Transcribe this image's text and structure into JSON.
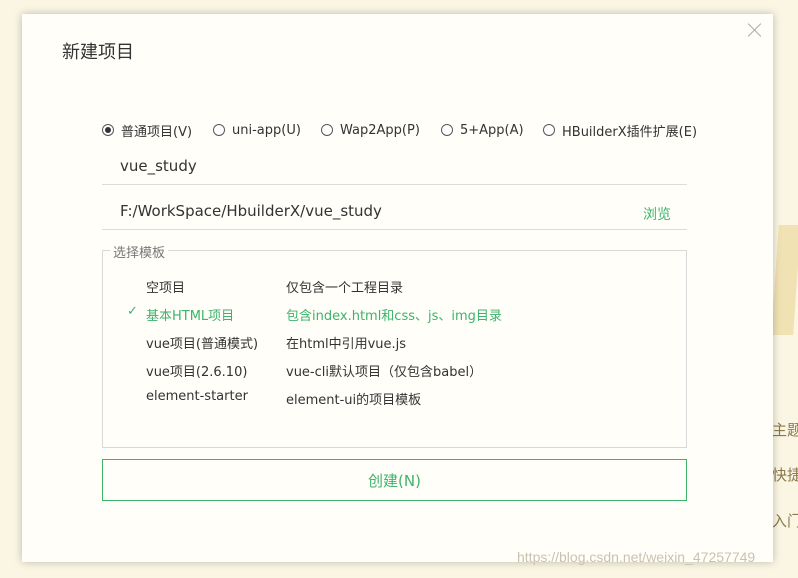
{
  "dialog": {
    "title": "新建项目",
    "close": "×"
  },
  "project_types": [
    {
      "label": "普通项目(V)",
      "selected": true
    },
    {
      "label": "uni-app(U)",
      "selected": false
    },
    {
      "label": "Wap2App(P)",
      "selected": false
    },
    {
      "label": "5+App(A)",
      "selected": false
    },
    {
      "label": "HBuilderX插件扩展(E)",
      "selected": false
    }
  ],
  "project_name": {
    "value": "vue_study"
  },
  "project_path": {
    "value": "F:/WorkSpace/HbuilderX/vue_study",
    "browse_label": "浏览"
  },
  "templates": {
    "legend": "选择模板",
    "items": [
      {
        "name": "空项目",
        "desc": "仅包含一个工程目录",
        "selected": false
      },
      {
        "name": "基本HTML项目",
        "desc": "包含index.html和css、js、img目录",
        "selected": true
      },
      {
        "name": "vue项目(普通模式)",
        "desc": "在html中引用vue.js",
        "selected": false
      },
      {
        "name": "vue项目(2.6.10)",
        "desc": "vue-cli默认项目（仅包含babel）",
        "selected": false
      },
      {
        "name": "element-starter",
        "desc": "element-ui的项目模板",
        "selected": false
      }
    ],
    "check_mark": "✓"
  },
  "create_button": {
    "label": "创建(N)"
  },
  "background": {
    "side_texts": [
      "主题",
      "快捷",
      "入门"
    ],
    "watermark": "https://blog.csdn.net/weixin_47257749"
  },
  "colors": {
    "accent": "#3db36b",
    "background": "#fbf6e3"
  }
}
